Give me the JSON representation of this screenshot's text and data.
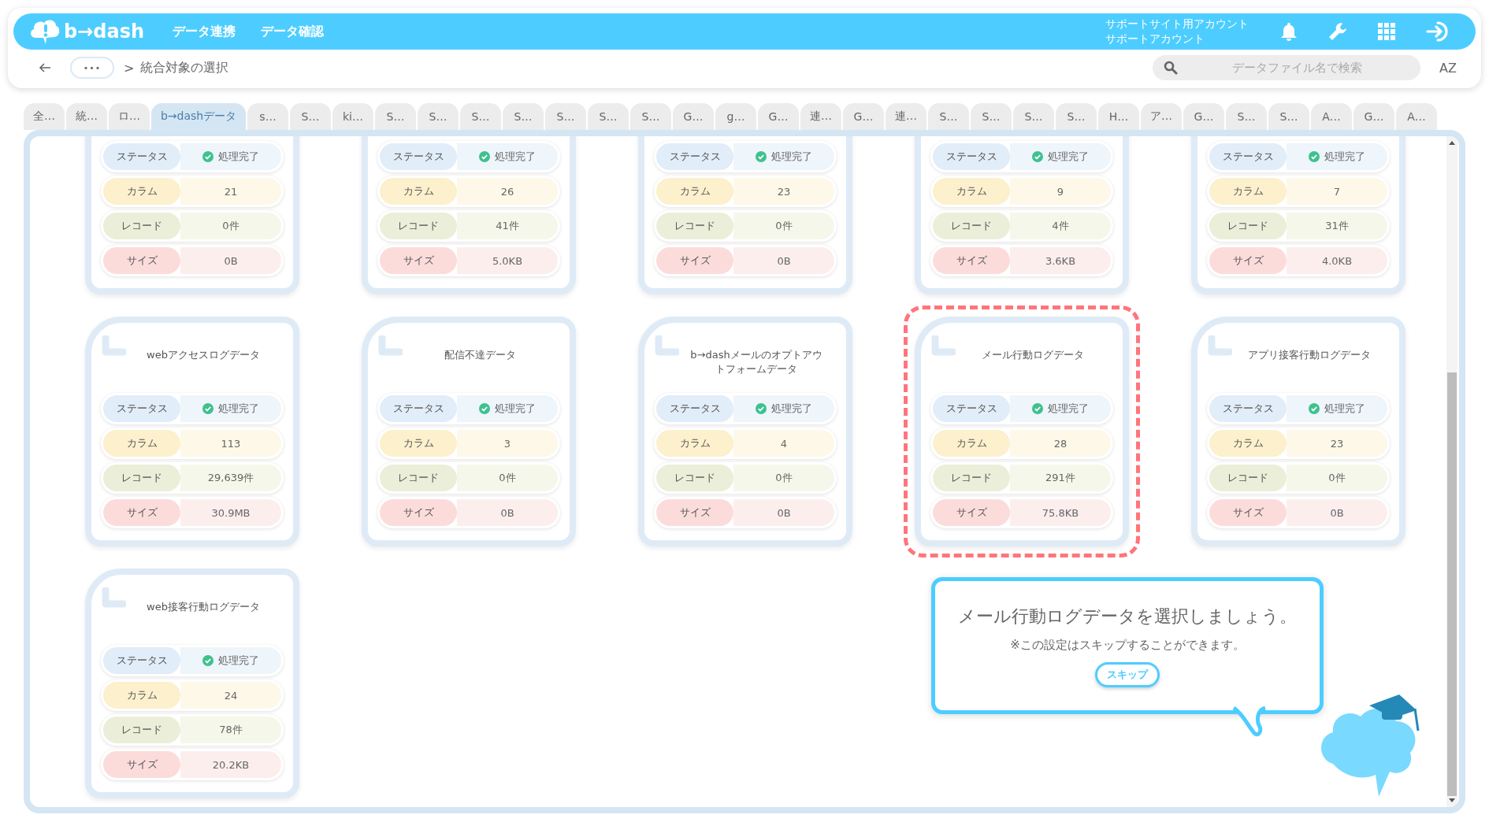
{
  "header": {
    "logo": "b→dash",
    "nav": [
      {
        "label": "データ連携"
      },
      {
        "label": "データ確認"
      }
    ],
    "account": [
      "サポートサイト用アカウント",
      "サポートアカウント"
    ]
  },
  "breadcrumb": {
    "more": "•••",
    "separator": ">",
    "current": "統合対象の選択"
  },
  "search": {
    "placeholder": "データファイル名で検索"
  },
  "sort_button": "AZ",
  "tabs": [
    {
      "label": "全…",
      "selected": false
    },
    {
      "label": "統…",
      "selected": false
    },
    {
      "label": "ロ…",
      "selected": false
    },
    {
      "label": "b→dashデータ",
      "selected": true
    },
    {
      "label": "s…",
      "selected": false
    },
    {
      "label": "S…",
      "selected": false
    },
    {
      "label": "ki…",
      "selected": false
    },
    {
      "label": "S…",
      "selected": false
    },
    {
      "label": "S…",
      "selected": false
    },
    {
      "label": "S…",
      "selected": false
    },
    {
      "label": "S…",
      "selected": false
    },
    {
      "label": "S…",
      "selected": false
    },
    {
      "label": "S…",
      "selected": false
    },
    {
      "label": "S…",
      "selected": false
    },
    {
      "label": "G…",
      "selected": false
    },
    {
      "label": "g…",
      "selected": false
    },
    {
      "label": "G…",
      "selected": false
    },
    {
      "label": "連…",
      "selected": false
    },
    {
      "label": "G…",
      "selected": false
    },
    {
      "label": "連…",
      "selected": false
    },
    {
      "label": "S…",
      "selected": false
    },
    {
      "label": "S…",
      "selected": false
    },
    {
      "label": "S…",
      "selected": false
    },
    {
      "label": "S…",
      "selected": false
    },
    {
      "label": "H…",
      "selected": false
    },
    {
      "label": "ア…",
      "selected": false
    },
    {
      "label": "G…",
      "selected": false
    },
    {
      "label": "S…",
      "selected": false
    },
    {
      "label": "S…",
      "selected": false
    },
    {
      "label": "A…",
      "selected": false
    },
    {
      "label": "G…",
      "selected": false
    },
    {
      "label": "A…",
      "selected": false
    }
  ],
  "cards": [
    {
      "selected": false,
      "rows": [
        {
          "kind": "status",
          "label": "ステータス",
          "value": "処理完了"
        },
        {
          "kind": "column",
          "label": "カラム",
          "value": "21"
        },
        {
          "kind": "record",
          "label": "レコード",
          "value": "0件"
        },
        {
          "kind": "size",
          "label": "サイズ",
          "value": "0B"
        }
      ]
    },
    {
      "selected": false,
      "rows": [
        {
          "kind": "status",
          "label": "ステータス",
          "value": "処理完了"
        },
        {
          "kind": "column",
          "label": "カラム",
          "value": "26"
        },
        {
          "kind": "record",
          "label": "レコード",
          "value": "41件"
        },
        {
          "kind": "size",
          "label": "サイズ",
          "value": "5.0KB"
        }
      ]
    },
    {
      "selected": false,
      "rows": [
        {
          "kind": "status",
          "label": "ステータス",
          "value": "処理完了"
        },
        {
          "kind": "column",
          "label": "カラム",
          "value": "23"
        },
        {
          "kind": "record",
          "label": "レコード",
          "value": "0件"
        },
        {
          "kind": "size",
          "label": "サイズ",
          "value": "0B"
        }
      ]
    },
    {
      "selected": false,
      "rows": [
        {
          "kind": "status",
          "label": "ステータス",
          "value": "処理完了"
        },
        {
          "kind": "column",
          "label": "カラム",
          "value": "9"
        },
        {
          "kind": "record",
          "label": "レコード",
          "value": "4件"
        },
        {
          "kind": "size",
          "label": "サイズ",
          "value": "3.6KB"
        }
      ]
    },
    {
      "selected": false,
      "rows": [
        {
          "kind": "status",
          "label": "ステータス",
          "value": "処理完了"
        },
        {
          "kind": "column",
          "label": "カラム",
          "value": "7"
        },
        {
          "kind": "record",
          "label": "レコード",
          "value": "31件"
        },
        {
          "kind": "size",
          "label": "サイズ",
          "value": "4.0KB"
        }
      ]
    },
    {
      "title": "webアクセスログデータ",
      "selected": false,
      "rows": [
        {
          "kind": "status",
          "label": "ステータス",
          "value": "処理完了"
        },
        {
          "kind": "column",
          "label": "カラム",
          "value": "113"
        },
        {
          "kind": "record",
          "label": "レコード",
          "value": "29,639件"
        },
        {
          "kind": "size",
          "label": "サイズ",
          "value": "30.9MB"
        }
      ]
    },
    {
      "title": "配信不達データ",
      "selected": false,
      "rows": [
        {
          "kind": "status",
          "label": "ステータス",
          "value": "処理完了"
        },
        {
          "kind": "column",
          "label": "カラム",
          "value": "3"
        },
        {
          "kind": "record",
          "label": "レコード",
          "value": "0件"
        },
        {
          "kind": "size",
          "label": "サイズ",
          "value": "0B"
        }
      ]
    },
    {
      "title": "b→dashメールのオプトアウトフォームデータ",
      "selected": false,
      "rows": [
        {
          "kind": "status",
          "label": "ステータス",
          "value": "処理完了"
        },
        {
          "kind": "column",
          "label": "カラム",
          "value": "4"
        },
        {
          "kind": "record",
          "label": "レコード",
          "value": "0件"
        },
        {
          "kind": "size",
          "label": "サイズ",
          "value": "0B"
        }
      ]
    },
    {
      "title": "メール行動ログデータ",
      "selected": true,
      "rows": [
        {
          "kind": "status",
          "label": "ステータス",
          "value": "処理完了"
        },
        {
          "kind": "column",
          "label": "カラム",
          "value": "28"
        },
        {
          "kind": "record",
          "label": "レコード",
          "value": "291件"
        },
        {
          "kind": "size",
          "label": "サイズ",
          "value": "75.8KB"
        }
      ]
    },
    {
      "title": "アプリ接客行動ログデータ",
      "selected": false,
      "rows": [
        {
          "kind": "status",
          "label": "ステータス",
          "value": "処理完了"
        },
        {
          "kind": "column",
          "label": "カラム",
          "value": "23"
        },
        {
          "kind": "record",
          "label": "レコード",
          "value": "0件"
        },
        {
          "kind": "size",
          "label": "サイズ",
          "value": "0B"
        }
      ]
    },
    {
      "title": "web接客行動ログデータ",
      "selected": false,
      "rows": [
        {
          "kind": "status",
          "label": "ステータス",
          "value": "処理完了"
        },
        {
          "kind": "column",
          "label": "カラム",
          "value": "24"
        },
        {
          "kind": "record",
          "label": "レコード",
          "value": "78件"
        },
        {
          "kind": "size",
          "label": "サイズ",
          "value": "20.2KB"
        }
      ]
    }
  ],
  "guide": {
    "message": "メール行動ログデータを選択しましょう。",
    "note": "※この設定はスキップすることができます。",
    "button": "スキップ"
  }
}
